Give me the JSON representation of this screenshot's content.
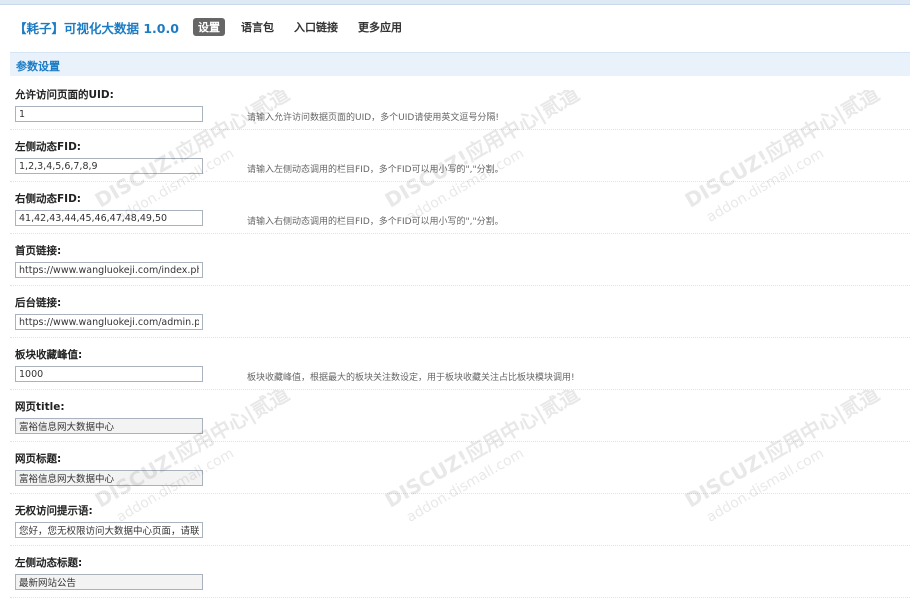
{
  "header": {
    "app_title": "【耗子】可视化大数据 1.0.0",
    "nav": [
      {
        "label": "设置",
        "active": true
      },
      {
        "label": "语言包",
        "active": false
      },
      {
        "label": "入口链接",
        "active": false
      },
      {
        "label": "更多应用",
        "active": false
      }
    ]
  },
  "section": {
    "title": "参数设置"
  },
  "settings": [
    {
      "label": "允许访问页面的UID:",
      "value": "1",
      "hint": "请输入允许访问数据页面的UID，多个UID请使用英文逗号分隔!"
    },
    {
      "label": "左侧动态FID:",
      "value": "1,2,3,4,5,6,7,8,9",
      "hint": "请输入左侧动态调用的栏目FID，多个FID可以用小写的\",\"分割。"
    },
    {
      "label": "右侧动态FID:",
      "value": "41,42,43,44,45,46,47,48,49,50",
      "hint": "请输入右侧动态调用的栏目FID，多个FID可以用小写的\",\"分割。"
    },
    {
      "label": "首页链接:",
      "value": "https://www.wangluokeji.com/index.php",
      "hint": ""
    },
    {
      "label": "后台链接:",
      "value": "https://www.wangluokeji.com/admin.php",
      "hint": ""
    },
    {
      "label": "板块收藏峰值:",
      "value": "1000",
      "hint": "板块收藏峰值，根据最大的板块关注数设定，用于板块收藏关注占比板块模块调用!"
    },
    {
      "label": "网页title:",
      "value": "富裕信息网大数据中心",
      "hint": ""
    },
    {
      "label": "网页标题:",
      "value": "富裕信息网大数据中心",
      "hint": ""
    },
    {
      "label": "无权访问提示语:",
      "value": "您好，您无权限访问大数据中心页面，请联系管",
      "hint": ""
    },
    {
      "label": "左侧动态标题:",
      "value": "最新网站公告",
      "hint": ""
    }
  ],
  "watermark": {
    "line1": "DISCUZ!应用中心|贰道",
    "line2": "addon.dismall.com"
  }
}
